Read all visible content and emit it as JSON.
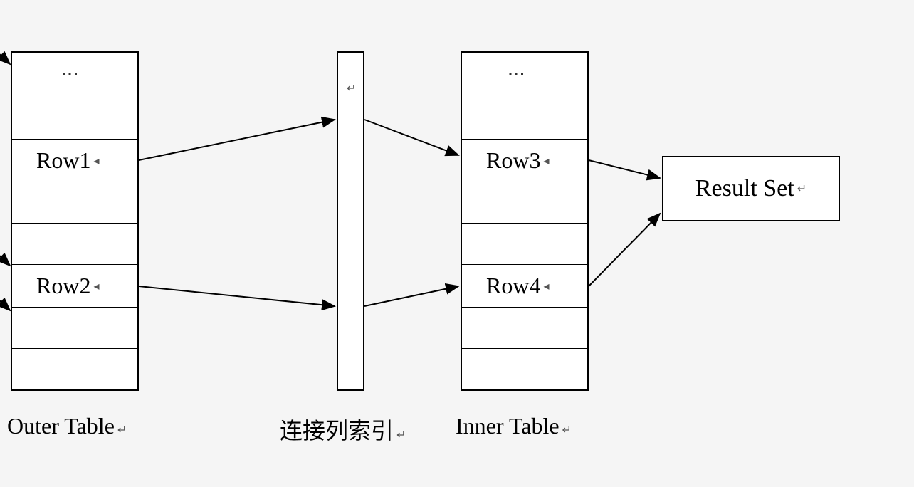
{
  "outerTable": {
    "label": "Outer Table",
    "rows": {
      "row1": "Row1",
      "row2": "Row2"
    }
  },
  "indexColumn": {
    "label": "连接列索引"
  },
  "innerTable": {
    "label": "Inner Table",
    "rows": {
      "row3": "Row3",
      "row4": "Row4"
    }
  },
  "resultSet": {
    "label": "Result Set"
  },
  "markers": {
    "small_arrow": "↵",
    "small_tri": "◂"
  }
}
